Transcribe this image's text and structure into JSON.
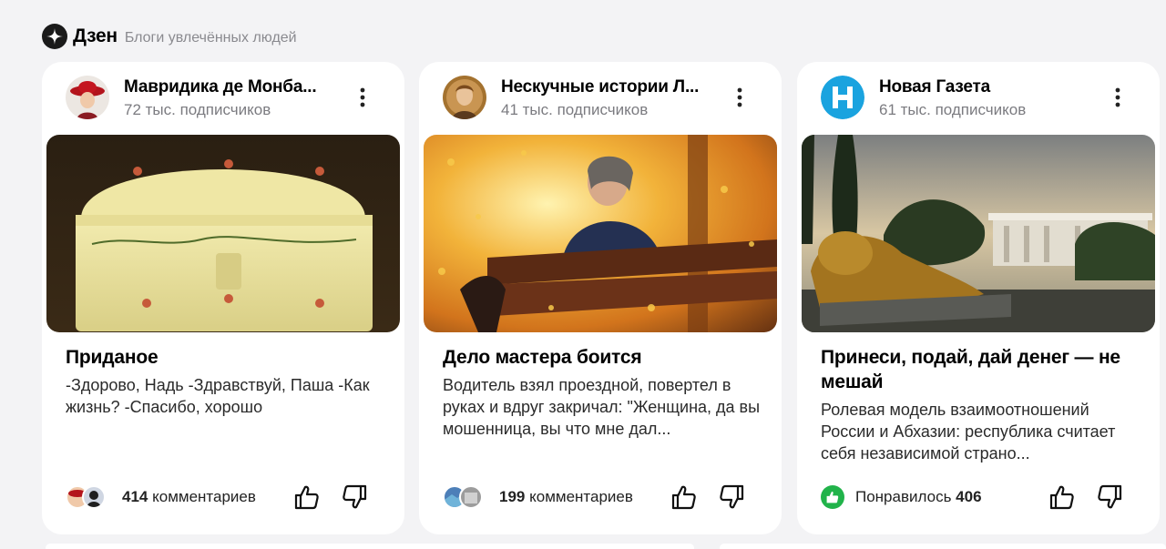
{
  "header": {
    "brand": "Дзен",
    "tagline": "Блоги увлечённых людей",
    "logo_icon": "zen-star-icon"
  },
  "cards": [
    {
      "channel": "Мавридика де Монба...",
      "subscribers": "72 тыс. подписчиков",
      "title": "Приданое",
      "snippet": "-Здорово, Надь -Здравствуй, Паша -Как жизнь? -Спасибо, хорошо",
      "comments_count": "414",
      "comments_label": "комментариев",
      "avatar_icon": "lady-in-red-hat-avatar",
      "cover_icon": "yellow-chest-image"
    },
    {
      "channel": "Нескучные истории Л...",
      "subscribers": "41 тыс. подписчиков",
      "title": "Дело мастера боится",
      "snippet": "Водитель взял проездной, повертел в руках и вдруг закричал: \"Женщина, да вы мошенница, вы что мне дал...",
      "comments_count": "199",
      "comments_label": "комментариев",
      "avatar_icon": "portrait-avatar",
      "cover_icon": "woman-on-bench-autumn-image"
    },
    {
      "channel": "Новая Газета",
      "subscribers": "61 тыс. подписчиков",
      "title": "Принеси, подай, дай денег — не мешай",
      "snippet": "Ролевая модель взаимоотношений России и Абхазии: республика считает себя независимой страно...",
      "liked_label": "Понравилось",
      "liked_count": "406",
      "avatar_icon": "novaya-gazeta-logo",
      "cover_icon": "golden-lion-statue-image"
    }
  ],
  "colors": {
    "background": "#f3f3f5",
    "card": "#ffffff",
    "liked_green": "#21b34a",
    "novaya_blue": "#1aa3df"
  }
}
